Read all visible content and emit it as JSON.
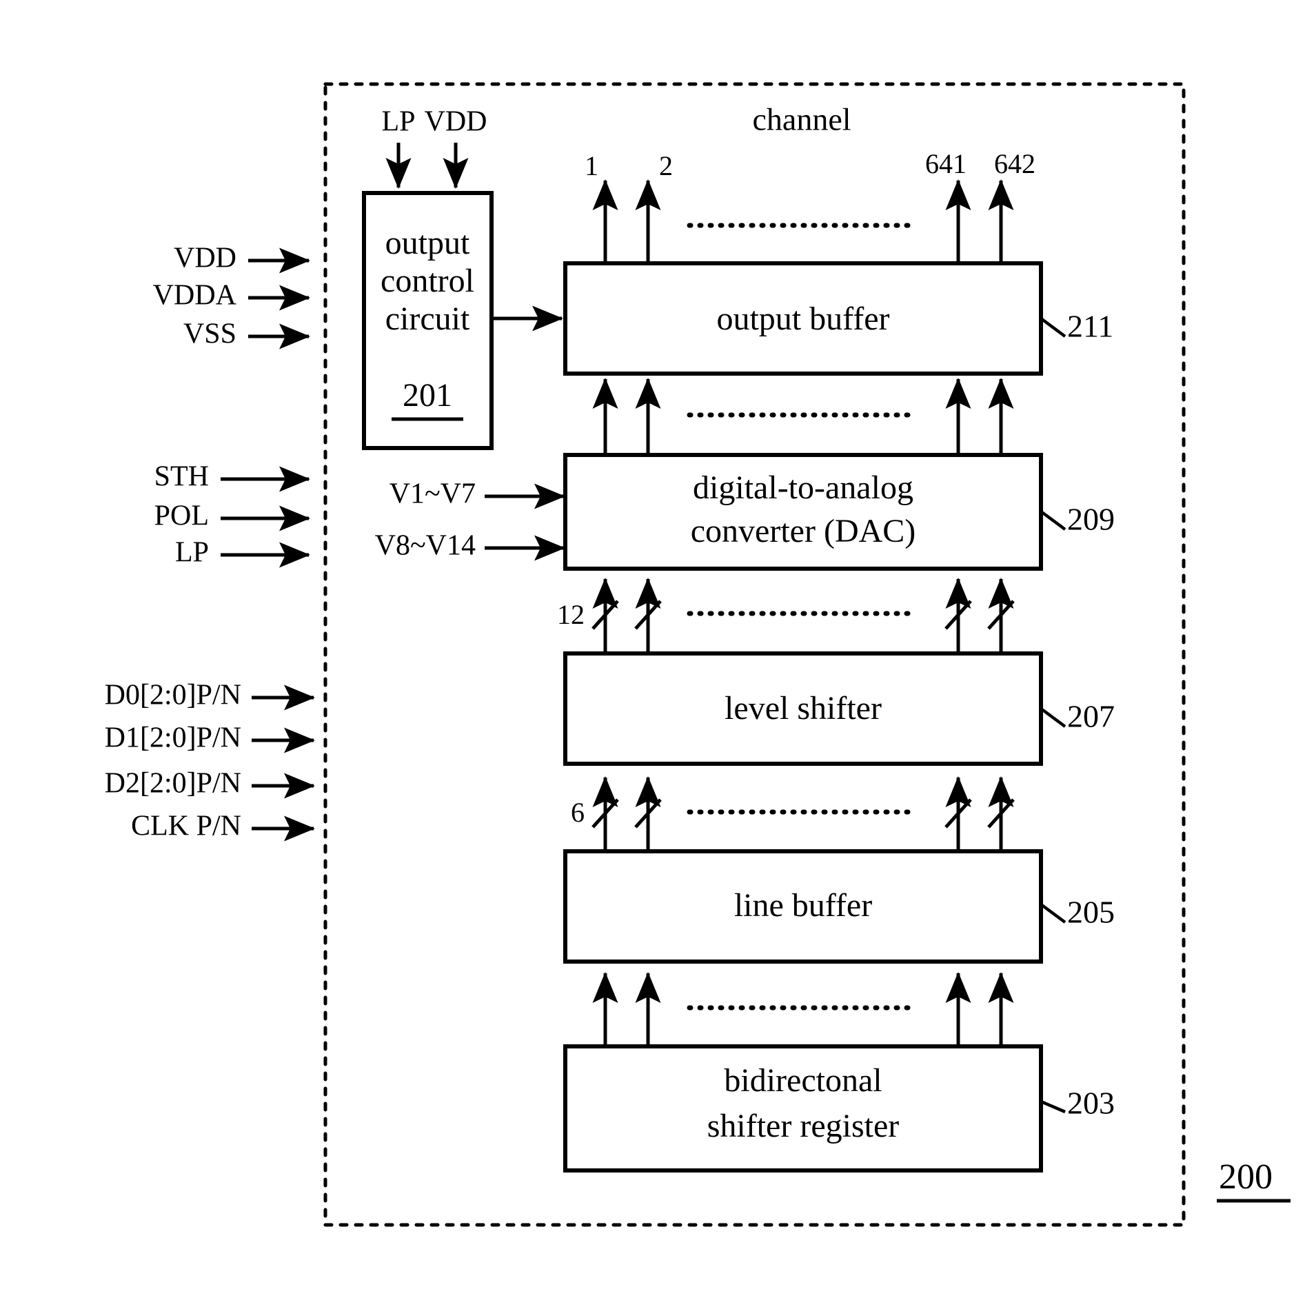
{
  "figure": {
    "reference_number": "200",
    "enclosure_label": "channel"
  },
  "top_supply_labels": [
    {
      "text": "LP"
    },
    {
      "text": "VDD"
    }
  ],
  "channel_numbers": [
    {
      "text": "1"
    },
    {
      "text": "2"
    },
    {
      "text": "641"
    },
    {
      "text": "642"
    }
  ],
  "left_signals": [
    {
      "text": "VDD"
    },
    {
      "text": "VDDA"
    },
    {
      "text": "VSS"
    },
    {
      "text": "STH"
    },
    {
      "text": "POL"
    },
    {
      "text": "LP"
    },
    {
      "text": "D0[2:0]P/N"
    },
    {
      "text": "D1[2:0]P/N"
    },
    {
      "text": "D2[2:0]P/N"
    },
    {
      "text": "CLK P/N"
    }
  ],
  "reference_voltages": [
    {
      "text": "V1~V7"
    },
    {
      "text": "V8~V14"
    }
  ],
  "blocks": [
    {
      "id": "output-control-circuit",
      "lines": [
        "output",
        "control",
        "circuit"
      ],
      "ref": "201"
    },
    {
      "id": "output-buffer",
      "lines": [
        "output buffer"
      ],
      "ref": "211"
    },
    {
      "id": "digital-to-analog-converter",
      "lines": [
        "digital-to-analog",
        "converter (DAC)"
      ],
      "ref": "209"
    },
    {
      "id": "level-shifter",
      "lines": [
        "level shifter"
      ],
      "ref": "207"
    },
    {
      "id": "line-buffer",
      "lines": [
        "line buffer"
      ],
      "ref": "205"
    },
    {
      "id": "bidirectional-shifter-register",
      "lines": [
        "bidirectonal",
        "shifter register"
      ],
      "ref": "203"
    }
  ],
  "bus_widths": [
    {
      "text": "12"
    },
    {
      "text": "6"
    }
  ],
  "colors": {
    "stroke": "#000000",
    "background": "#ffffff",
    "text": "#000000"
  }
}
